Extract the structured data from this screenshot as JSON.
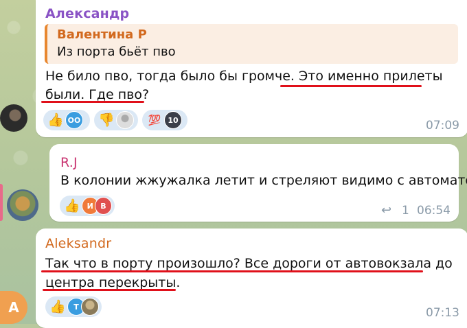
{
  "messages": [
    {
      "sender": "Александр",
      "sender_color": "#8a53c5",
      "quote": {
        "name": "Валентина Р",
        "text": "Из порта бьёт пво"
      },
      "text_line1": "Не било пво, тогда было бы громче. Это именно прилеты",
      "text_line2": "были. Где пво?",
      "reactions": [
        {
          "emoji": "👍",
          "avatars": [
            "ОО"
          ]
        },
        {
          "emoji": "👎",
          "avatars": [
            ""
          ]
        },
        {
          "emoji": "💯",
          "avatars": [
            "10"
          ]
        }
      ],
      "time": "07:09"
    },
    {
      "sender": "R.J",
      "sender_color": "#c8326f",
      "text_line1": "В колонии жжужалка летит и стреляют видимо с автоматов",
      "reactions": [
        {
          "emoji": "👍",
          "avatars": [
            "И",
            "В"
          ]
        }
      ],
      "replies": "1",
      "time": "06:54"
    },
    {
      "sender": "Aleksandr",
      "sender_color": "#d2691e",
      "text_line1": "Так что в порту произошло? Все дороги от автовокзала до",
      "text_line2": "центра перекрыты.",
      "reactions": [
        {
          "emoji": "👍",
          "avatars": [
            "Т",
            ""
          ]
        }
      ],
      "time": "07:13"
    }
  ],
  "side_avatar_letter": "A",
  "colors": {
    "underline": "#e0101a",
    "reaction_bg": "#dbe8f5",
    "time": "#8a9aa8"
  }
}
